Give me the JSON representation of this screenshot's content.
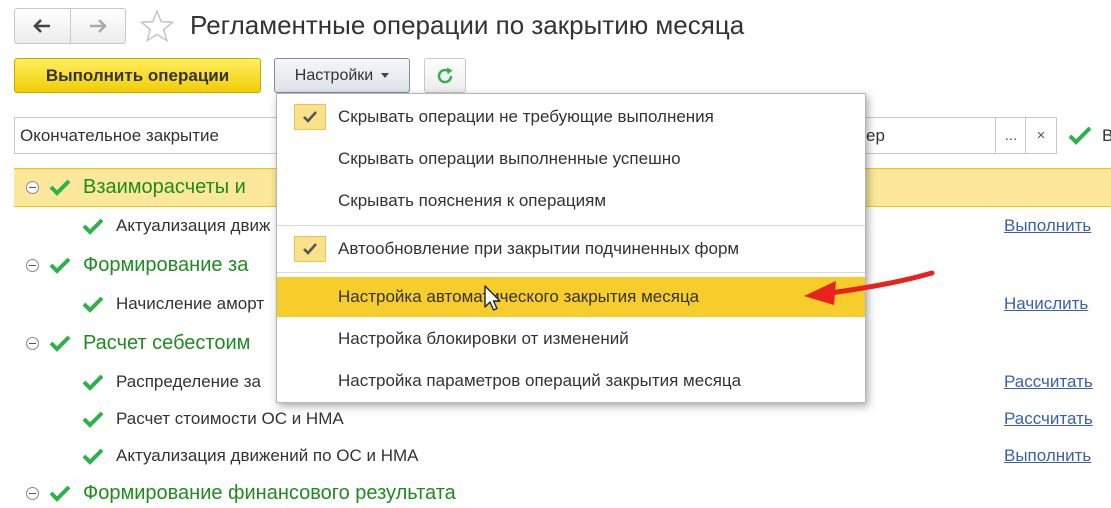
{
  "header": {
    "back_icon": "arrow-left-icon",
    "forward_icon": "arrow-right-icon",
    "favorite_icon": "star-outline-icon",
    "title": "Регламентные операции по закрытию месяца"
  },
  "toolbar": {
    "execute_label": "Выполнить операции",
    "settings_label": "Настройки",
    "refresh_icon": "refresh-icon"
  },
  "filter": {
    "left_value": "Окончательное закрытие",
    "right_value_partial": "ер",
    "more_label": "...",
    "clear_label": "×",
    "tail_text": "В"
  },
  "tree": {
    "groups": [
      {
        "label": "Взаиморасчеты и"
      },
      {
        "label": "Формирование за"
      },
      {
        "label": "Расчет себестоим"
      },
      {
        "label": "Формирование финансового результата"
      }
    ],
    "items": [
      {
        "label": "Актуализация движ",
        "action": "Выполнить"
      },
      {
        "label": "Начисление аморт",
        "action": "Начислить"
      },
      {
        "label": "Распределение за",
        "action": "Рассчитать"
      },
      {
        "label": "Расчет стоимости ОС и НМА",
        "action": "Рассчитать"
      },
      {
        "label": "Актуализация движений по ОС и НМА",
        "action": "Выполнить"
      }
    ]
  },
  "settings_menu": {
    "items": [
      {
        "label": "Скрывать операции не требующие выполнения",
        "checked": true
      },
      {
        "label": "Скрывать операции выполненные успешно",
        "checked": false
      },
      {
        "label": "Скрывать пояснения к операциям",
        "checked": false
      },
      {
        "label": "Автообновление при закрытии подчиненных форм",
        "checked": true
      },
      {
        "label": "Настройка автоматического закрытия месяца",
        "highlighted": true
      },
      {
        "label": "Настройка блокировки от изменений"
      },
      {
        "label": "Настройка параметров операций закрытия месяца"
      }
    ]
  },
  "colors": {
    "accent_yellow": "#f2cd05",
    "success_green": "#2db14a",
    "group_green": "#1f8b1f",
    "link_blue": "#3a5fb0",
    "annotation_red": "#e8231f"
  }
}
